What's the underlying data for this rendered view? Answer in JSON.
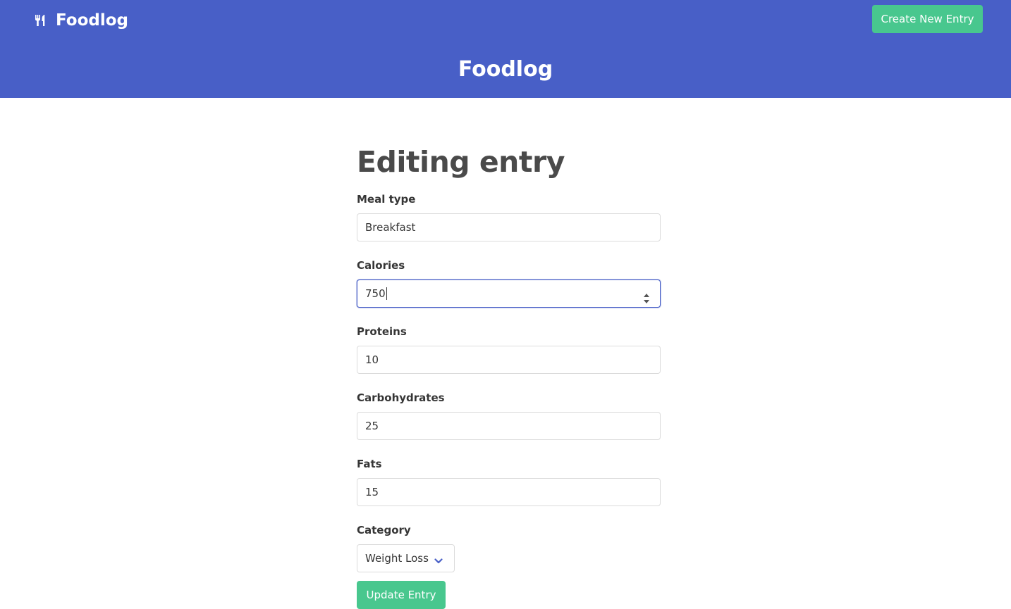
{
  "navbar": {
    "brand": "Foodlog",
    "brand_icon": "utensils-icon",
    "create_button": "Create New Entry"
  },
  "hero": {
    "title": "Foodlog"
  },
  "form": {
    "heading": "Editing entry",
    "meal_type": {
      "label": "Meal type",
      "value": "Breakfast"
    },
    "calories": {
      "label": "Calories",
      "value": "750"
    },
    "proteins": {
      "label": "Proteins",
      "value": "10"
    },
    "carbohydrates": {
      "label": "Carbohydrates",
      "value": "25"
    },
    "fats": {
      "label": "Fats",
      "value": "15"
    },
    "category": {
      "label": "Category",
      "selected": "Weight Loss"
    },
    "submit": "Update Entry"
  },
  "colors": {
    "primary": "#485fc7",
    "success": "#48c78e",
    "text": "#363636"
  }
}
